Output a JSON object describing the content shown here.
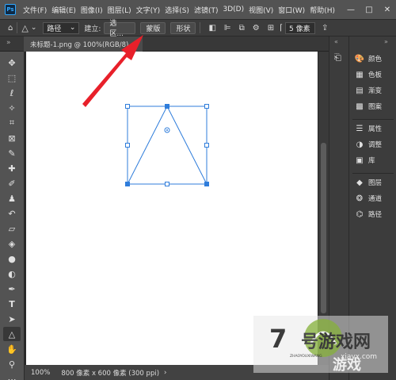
{
  "app": {
    "logo": "Ps"
  },
  "menu": [
    "文件(F)",
    "编辑(E)",
    "图像(I)",
    "图层(L)",
    "文字(Y)",
    "选择(S)",
    "滤镜(T)",
    "3D(D)",
    "视图(V)",
    "窗口(W)",
    "帮助(H)"
  ],
  "window_controls": {
    "minimize": "—",
    "maximize": "□",
    "close": "✕"
  },
  "options": {
    "mode_value": "路径",
    "build_label": "建立:",
    "selection_button": "选区...",
    "mask_button": "蒙版",
    "shape_button": "形状",
    "corner_radius": "5 像素"
  },
  "document": {
    "tab_title": "未标题-1.png @ 100%(RGB/8)"
  },
  "status": {
    "zoom": "100%",
    "info": "800 像素 x 600 像素 (300 ppi)"
  },
  "tools": [
    "move-tool",
    "marquee-tool",
    "lasso-tool",
    "magic-wand-tool",
    "crop-tool",
    "frame-tool",
    "eyedropper-tool",
    "healing-brush-tool",
    "brush-tool",
    "clone-stamp-tool",
    "history-brush-tool",
    "eraser-tool",
    "paint-bucket-tool",
    "blur-tool",
    "dodge-tool",
    "pen-tool",
    "type-tool",
    "path-selection-tool",
    "triangle-tool",
    "hand-tool",
    "zoom-tool",
    "more-tools"
  ],
  "panels": {
    "group1": [
      "颜色",
      "色板",
      "渐变",
      "图案"
    ],
    "group2": [
      "属性",
      "调整",
      "库"
    ],
    "group3": [
      "图层",
      "通道",
      "路径"
    ]
  },
  "watermark": {
    "brand": "7号游戏网",
    "url": "xiayx.com",
    "pinyin": "ZHAOYOUXIWANG"
  },
  "colors": {
    "accent": "#31a8ff",
    "arrow": "#e8202a",
    "path": "#2f7ddb"
  }
}
